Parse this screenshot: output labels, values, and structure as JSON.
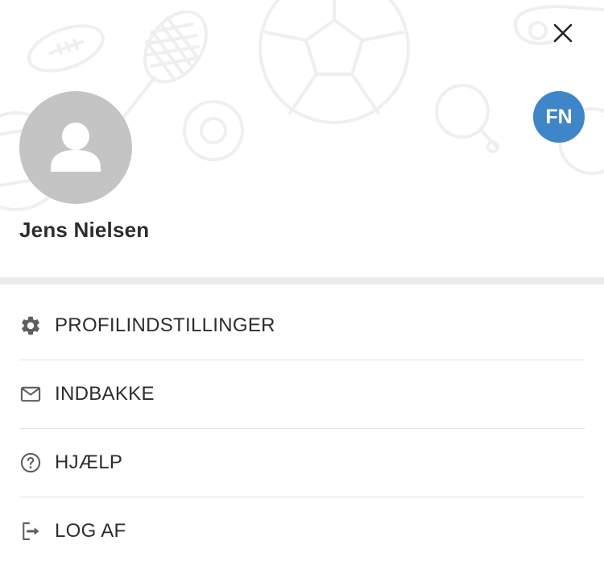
{
  "header": {
    "close_icon": "close-icon",
    "user": {
      "avatar_icon": "person-icon",
      "name": "Jens Nielsen"
    },
    "org_badge": {
      "initials": "FN",
      "color": "#3f86c9"
    }
  },
  "menu": {
    "items": [
      {
        "icon": "gear-icon",
        "label": "PROFILINDSTILLINGER"
      },
      {
        "icon": "envelope-icon",
        "label": "INDBAKKE"
      },
      {
        "icon": "help-circle-icon",
        "label": "HJÆLP"
      },
      {
        "icon": "logout-icon",
        "label": "LOG AF"
      }
    ]
  }
}
